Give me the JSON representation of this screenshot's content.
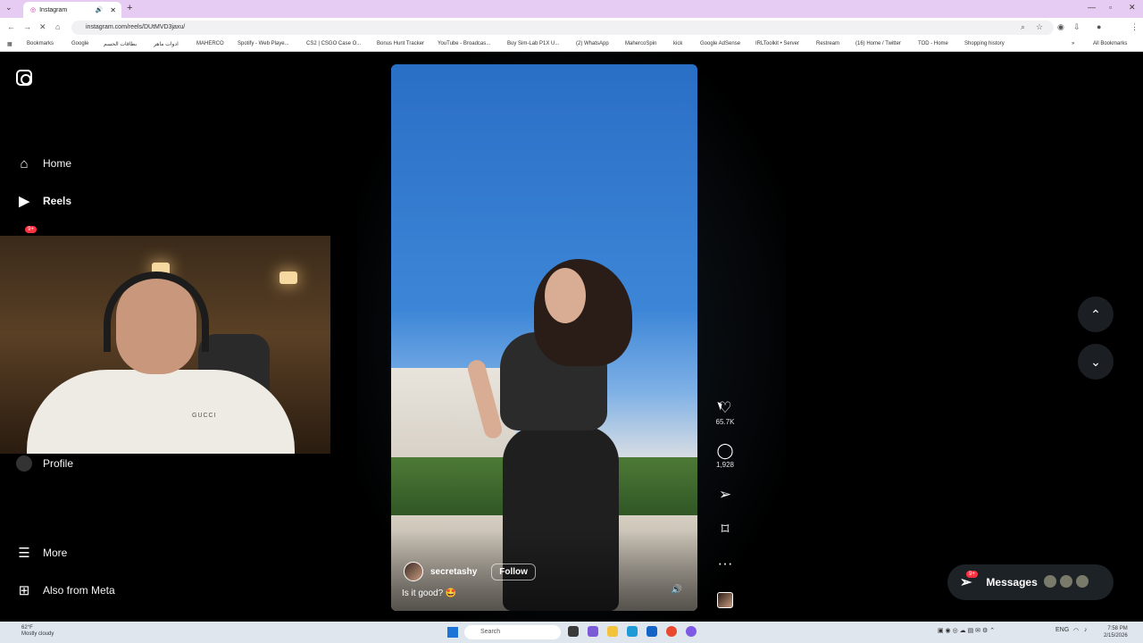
{
  "browser": {
    "tab_title": "Instagram",
    "tab_close": "✕",
    "new_tab": "+",
    "url": "instagram.com/reels/DUtMVD3jaxu/",
    "bookmarks": [
      "Bookmarks",
      "Google",
      "بطاقات الحسم",
      "ادوات ماهر",
      "MAHERCO",
      "Spotify - Web Playe...",
      "CS2 | CSGO Case O...",
      "Bonus Hunt Tracker",
      "YouTube - Broadcas...",
      "Buy Sim-Lab P1X U...",
      "(2) WhatsApp",
      "MahercoSpin",
      "kick",
      "Google AdSense",
      "IRLToolkit • Server",
      "Restream",
      "(16) Home / Twitter",
      "TOD - Home",
      "Shopping history"
    ],
    "all_bookmarks": "All Bookmarks"
  },
  "sidebar": {
    "items": [
      {
        "label": "Home",
        "icon": "home-icon"
      },
      {
        "label": "Reels",
        "icon": "reels-icon"
      },
      {
        "label": "Profile",
        "icon": "avatar"
      },
      {
        "label": "More",
        "icon": "menu-icon"
      },
      {
        "label": "Also from Meta",
        "icon": "grid-icon"
      }
    ],
    "badge": "9+"
  },
  "webcam": {
    "shirt_text": "GUCCI"
  },
  "reel": {
    "username": "secretashy",
    "follow_label": "Follow",
    "caption": "Is it good? 🤩",
    "likes": "65.7K",
    "comments": "1,928"
  },
  "messages": {
    "label": "Messages",
    "badge": "9+"
  },
  "taskbar": {
    "temp": "62°F",
    "weather": "Mostly cloudy",
    "search_placeholder": "Search",
    "lang": "ENG",
    "time": "7:58 PM",
    "date": "2/15/2026"
  },
  "colors": {
    "accent_badge": "#ff3040",
    "background": "#000000",
    "titlebar": "#e6ccf2"
  }
}
